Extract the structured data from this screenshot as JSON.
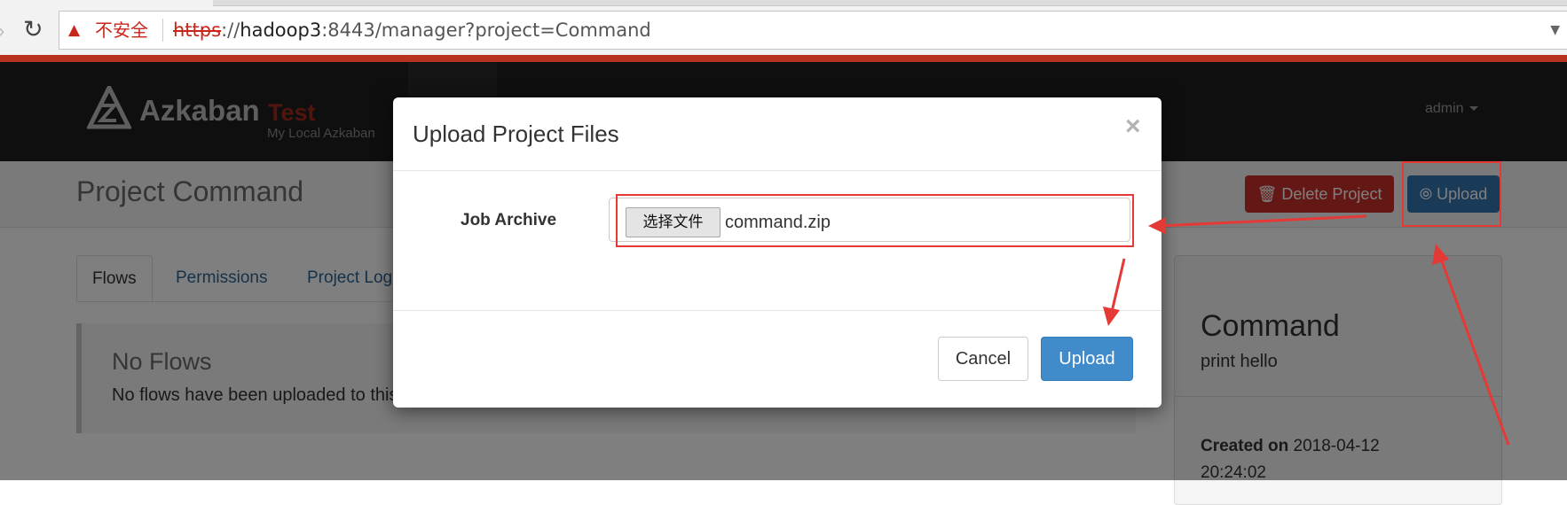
{
  "browser": {
    "security_label": "不安全",
    "url_scheme": "https",
    "url_host": "hadoop3",
    "url_rest": ":8443/manager?project=Command"
  },
  "navbar": {
    "brand_name": "Azkaban",
    "brand_env": "Test",
    "brand_subtitle": "My Local Azkaban",
    "user": "admin"
  },
  "header": {
    "title": "Project Command",
    "delete_label": "Delete Project",
    "upload_label": "Upload"
  },
  "tabs": [
    {
      "label": "Flows",
      "active": true
    },
    {
      "label": "Permissions",
      "active": false
    },
    {
      "label": "Project Log",
      "active": false
    }
  ],
  "flows_panel": {
    "heading": "No Flows",
    "message": "No flows have been uploaded to this project yet."
  },
  "project_info": {
    "name": "Command",
    "description": "print hello",
    "created_label": "Created on",
    "created_date": "2018-04-12",
    "created_time": "20:24:02"
  },
  "modal": {
    "title": "Upload Project Files",
    "close_glyph": "×",
    "field_label": "Job Archive",
    "choose_file_label": "选择文件",
    "file_name": "command.zip",
    "cancel_label": "Cancel",
    "upload_label": "Upload"
  },
  "colors": {
    "annotation": "#e53935",
    "primary": "#428bca",
    "danger": "#c9302c",
    "navbar": "#1e1e1e"
  }
}
